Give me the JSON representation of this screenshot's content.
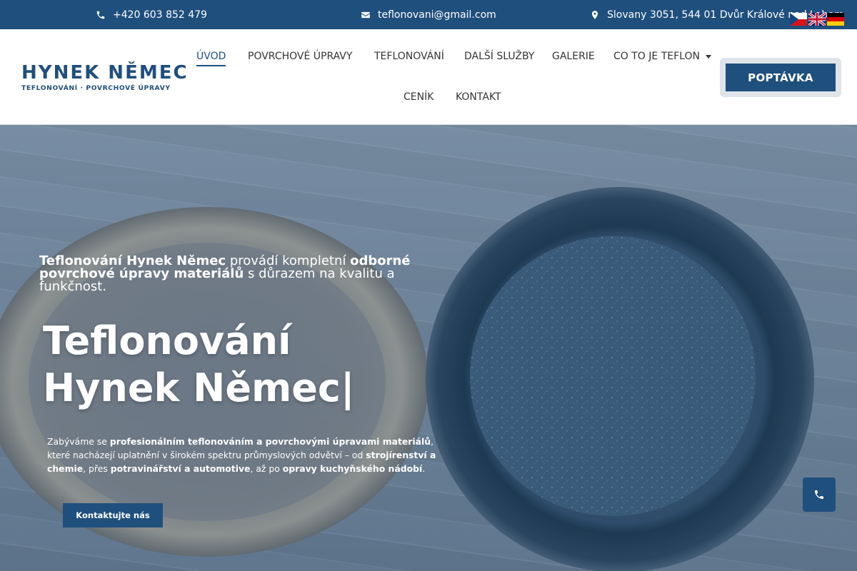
{
  "topbar": {
    "phone": "+420 603 852 479",
    "email": "teflonovani@gmail.com",
    "address": "Slovany 3051, 544 01 Dvůr Králové nad Labem",
    "icons": [
      "phone-icon",
      "envelope-icon",
      "map-pin-icon"
    ]
  },
  "languages": [
    "cz-flag",
    "en-flag",
    "de-flag"
  ],
  "logo": {
    "title": "HYNEK NĚMEC",
    "subtitle": "TEFLONOVÁNÍ · POVRCHOVÉ ÚPRAVY"
  },
  "nav": {
    "items": [
      {
        "label": "ÚVOD",
        "active": true
      },
      {
        "label": "POVRCHOVÉ ÚPRAVY"
      },
      {
        "label": "TEFLONOVÁNÍ"
      },
      {
        "label": "DALŠÍ SLUŽBY"
      },
      {
        "label": "GALERIE"
      },
      {
        "label": "CO TO JE TEFLON",
        "has_dropdown": true
      },
      {
        "label": "CENÍK"
      },
      {
        "label": "KONTAKT"
      }
    ],
    "cta": "POPTÁVKA"
  },
  "hero": {
    "lead_parts": [
      {
        "text": "Teflonování Hynek Němec",
        "bold": true
      },
      {
        "text": " provádí kompletní ",
        "bold": false
      },
      {
        "text": "odborné povrchové úpravy materiálů",
        "bold": true
      },
      {
        "text": " s důrazem na kvalitu a funkčnost.",
        "bold": false
      }
    ],
    "title_line1": "Teflonování",
    "title_line2": "Hynek Němec|",
    "text_parts": [
      {
        "text": "Zabýváme se ",
        "bold": false
      },
      {
        "text": "profesionálním teflonováním a povrchovými úpravami materiálů",
        "bold": true
      },
      {
        "text": ", které nacházejí uplatnění v širokém spektru průmyslových odvětví – od ",
        "bold": false
      },
      {
        "text": "strojírenství a chemie",
        "bold": true
      },
      {
        "text": ", přes ",
        "bold": false
      },
      {
        "text": "potravinářství a automotive",
        "bold": true
      },
      {
        "text": ", až po ",
        "bold": false
      },
      {
        "text": "opravy kuchyňského nádobí",
        "bold": true
      },
      {
        "text": ".",
        "bold": false
      }
    ],
    "button": "Kontaktujte nás"
  },
  "colors": {
    "brand": "#1f4f7d",
    "cta_frame": "#dfe4ea"
  },
  "floating": {
    "icon": "phone-icon"
  }
}
